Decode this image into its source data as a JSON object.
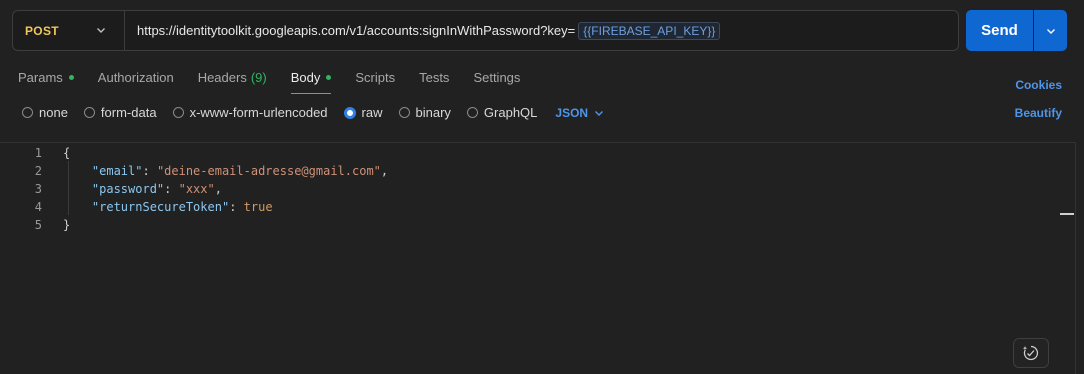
{
  "request": {
    "method": "POST",
    "url": "https://identitytoolkit.googleapis.com/v1/accounts:signInWithPassword?key=",
    "url_variable": "{{FIREBASE_API_KEY}}",
    "send_label": "Send"
  },
  "tabs": [
    {
      "label": "Params",
      "indicator": "dot"
    },
    {
      "label": "Authorization"
    },
    {
      "label": "Headers",
      "count": "(9)"
    },
    {
      "label": "Body",
      "indicator": "dot",
      "active": true
    },
    {
      "label": "Scripts"
    },
    {
      "label": "Tests"
    },
    {
      "label": "Settings"
    }
  ],
  "links": {
    "cookies": "Cookies",
    "beautify": "Beautify"
  },
  "body_types": [
    {
      "label": "none"
    },
    {
      "label": "form-data"
    },
    {
      "label": "x-www-form-urlencoded"
    },
    {
      "label": "raw",
      "selected": true
    },
    {
      "label": "binary"
    },
    {
      "label": "GraphQL"
    }
  ],
  "body_language": "JSON",
  "editor": {
    "line_numbers": [
      "1",
      "2",
      "3",
      "4",
      "5"
    ],
    "lines": {
      "l1": "{",
      "l2_key": "\"email\"",
      "l2_sep": ": ",
      "l2_val": "\"deine-email-adresse@gmail.com\"",
      "l2_end": ",",
      "l3_key": "\"password\"",
      "l3_sep": ": ",
      "l3_val": "\"xxx\"",
      "l3_end": ",",
      "l4_key": "\"returnSecureToken\"",
      "l4_sep": ": ",
      "l4_val": "true",
      "l5": "}"
    }
  },
  "colors": {
    "accent": "#0f67d2",
    "method": "#f0c75e",
    "active_tab_underline": "#f26b3a",
    "indicator": "#2fb562",
    "link": "#4f95e8"
  },
  "icons": {
    "method_dropdown": "chevron-down-icon",
    "send_dropdown": "chevron-down-icon",
    "language_dropdown": "chevron-down-icon",
    "ai_assist": "sparkle-assist-icon"
  }
}
